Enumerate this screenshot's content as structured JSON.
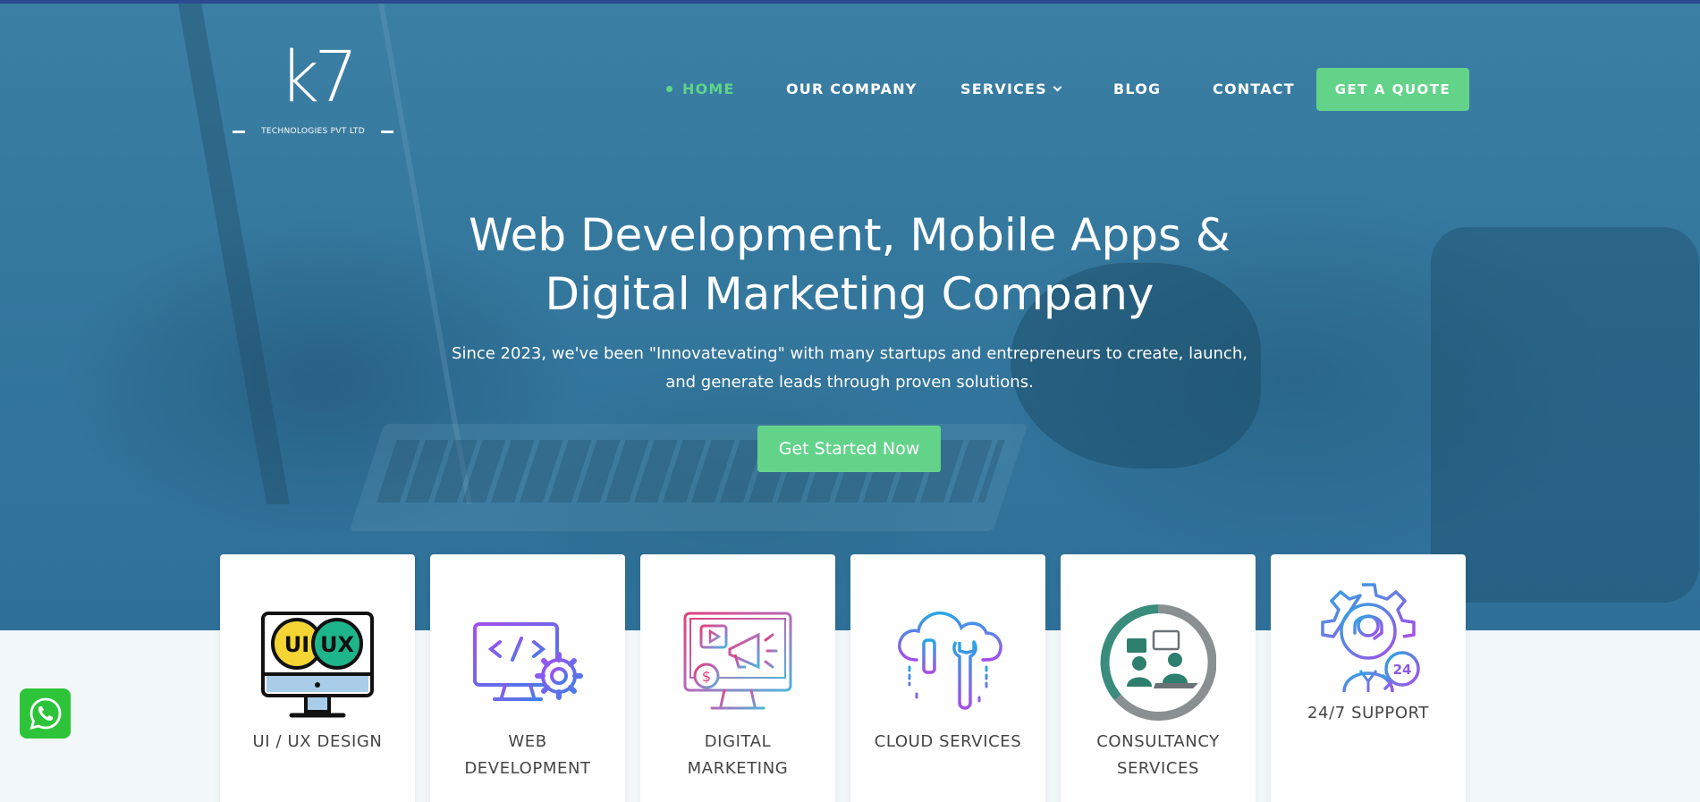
{
  "logo": {
    "mark": "k7",
    "tagline": "TECHNOLOGIES PVT LTD"
  },
  "nav": {
    "items": [
      {
        "label": "HOME",
        "active": true
      },
      {
        "label": "OUR COMPANY"
      },
      {
        "label": "SERVICES",
        "has_dropdown": true
      },
      {
        "label": "BLOG"
      },
      {
        "label": "CONTACT"
      }
    ],
    "quote_button": "GET A QUOTE"
  },
  "hero": {
    "title_line1": "Web Development, Mobile Apps &",
    "title_line2": "Digital Marketing Company",
    "subtitle_line1": "Since 2023, we've been \"Innovatevating\" with many startups and entrepreneurs to create, launch,",
    "subtitle_line2": "and generate leads through proven solutions.",
    "cta_label": "Get Started Now"
  },
  "services": [
    {
      "line1": "UI / UX DESIGN",
      "line2": "",
      "icon": "ui-ux-monitor-icon"
    },
    {
      "line1": "WEB",
      "line2": "DEVELOPMENT",
      "icon": "code-monitor-gear-icon"
    },
    {
      "line1": "DIGITAL",
      "line2": "MARKETING",
      "icon": "megaphone-monitor-icon"
    },
    {
      "line1": "CLOUD SERVICES",
      "line2": "",
      "icon": "cloud-tools-icon"
    },
    {
      "line1": "CONSULTANCY",
      "line2": "SERVICES",
      "icon": "consultancy-meeting-icon"
    },
    {
      "line1": "24/7 SUPPORT",
      "line2": "",
      "icon": "support-gear-headset-icon"
    }
  ],
  "floating": {
    "whatsapp_icon": "whatsapp-icon"
  },
  "colors": {
    "accent": "#63d38a",
    "hero_blue": "#3b7fa4",
    "text_dark": "#444444"
  }
}
